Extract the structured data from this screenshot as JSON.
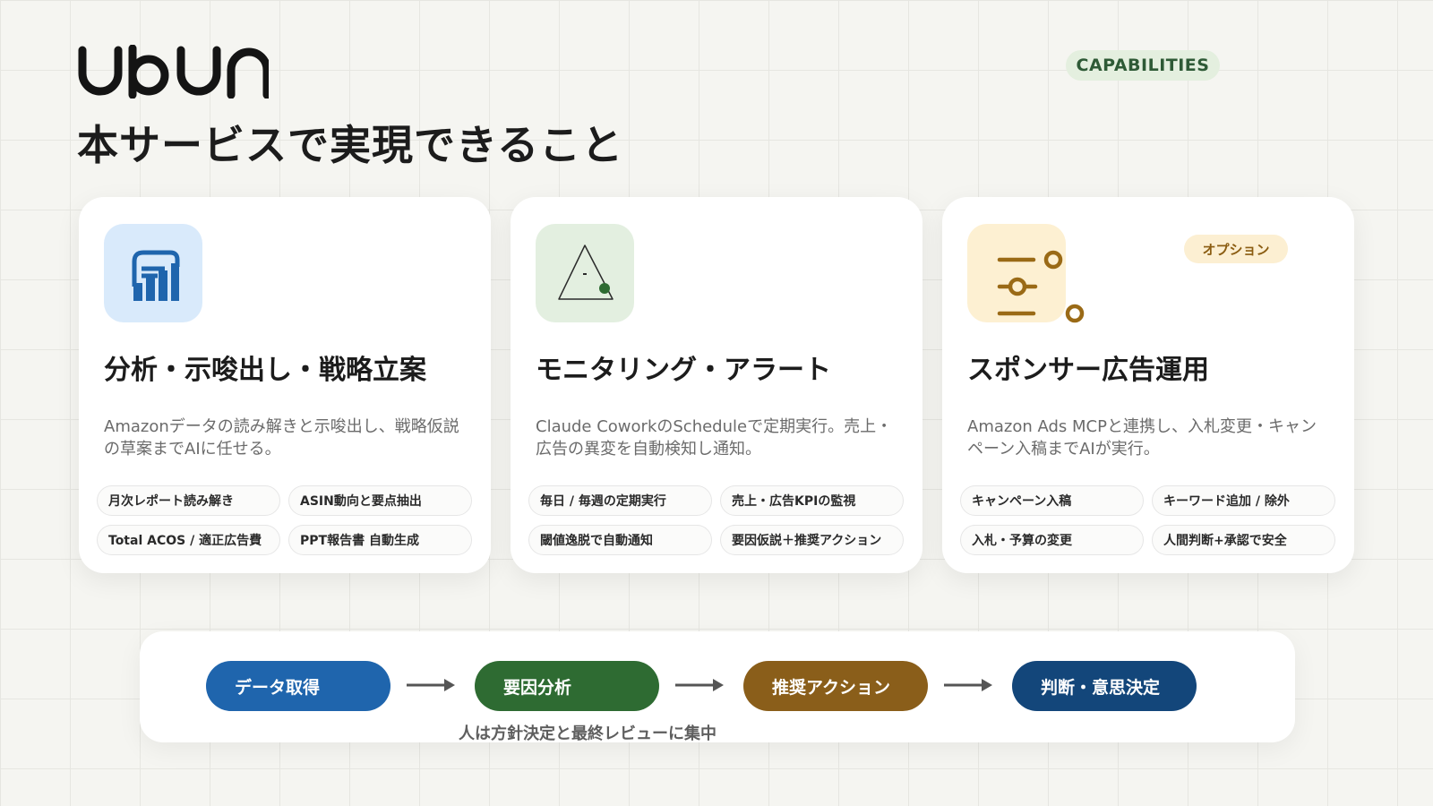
{
  "brand": {
    "logo_text": "UbUn"
  },
  "header": {
    "title": "本サービスで実現できること",
    "badge": "CAPABILITIES"
  },
  "cards": [
    {
      "icon": "analytics-chart-icon",
      "title": "分析・示唆出し・戦略立案",
      "description": "Amazonデータの読み解きと示唆出し、戦略仮説の草案までAIに任せる。",
      "chips": [
        "月次レポート読み解き",
        "ASIN動向と要点抽出",
        "Total ACOS / 適正広告費",
        "PPT報告書 自動生成"
      ]
    },
    {
      "icon": "alert-triangle-icon",
      "title": "モニタリング・アラート",
      "description": "Claude CoworkのScheduleで定期実行。売上・広告の異変を自動検知し通知。",
      "chips": [
        "毎日 / 毎週の定期実行",
        "売上・広告KPIの監視",
        "閾値逸脱で自動通知",
        "要因仮説＋推奨アクション"
      ]
    },
    {
      "icon": "sliders-icon",
      "title": "スポンサー広告運用",
      "option": "オプション",
      "description": "Amazon Ads MCPと連携し、入札変更・キャンペーン入稿までAIが実行。",
      "chips": [
        "キャンペーン入稿",
        "キーワード追加 / 除外",
        "入札・予算の変更",
        "人間判断+承認で安全"
      ]
    }
  ],
  "flow": {
    "steps": [
      "データ取得",
      "要因分析",
      "推奨アクション",
      "判断・意思決定"
    ],
    "note": "人は方針決定と最終レビューに集中"
  },
  "colors": {
    "step_1": "#1f65ad",
    "step_2": "#2e6b32",
    "step_3": "#8a5e1a",
    "step_4": "#13467a",
    "badge_text": "#2e5a36",
    "option_text": "#8b5d12"
  }
}
